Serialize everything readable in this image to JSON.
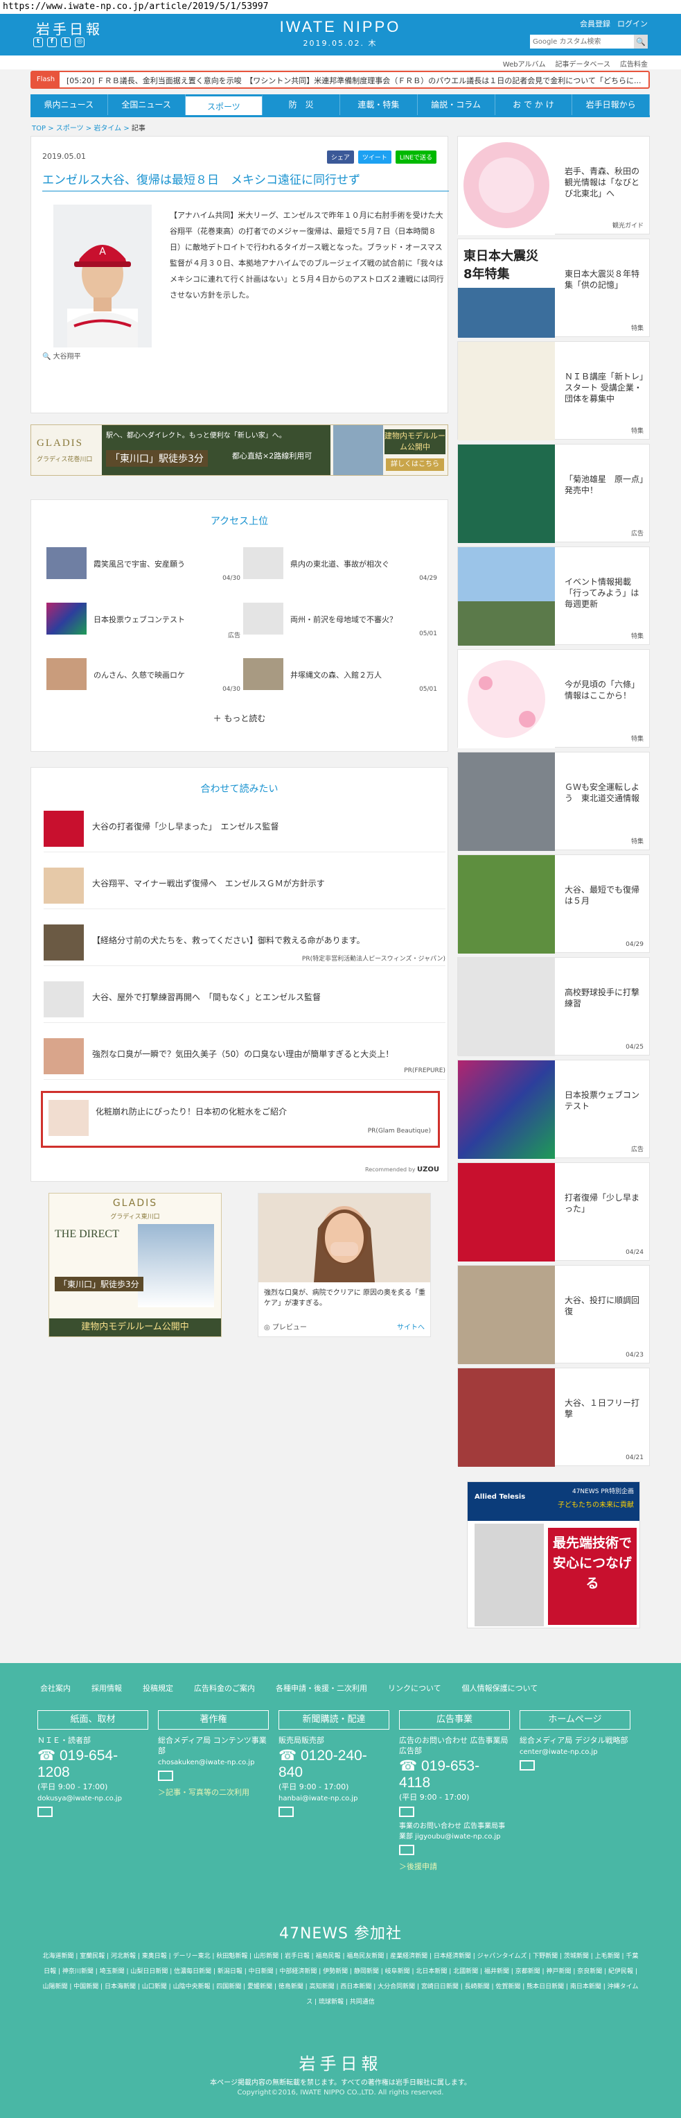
{
  "url": "https://www.iwate-np.co.jp/article/2019/5/1/53997",
  "header": {
    "logo_jp": "岩手日報",
    "logo_en": "IWATE NIPPO",
    "date": "2019.05.02. 木",
    "member_register": "会員登録",
    "login": "ログイン",
    "search_placeholder": "Google カスタム検索",
    "subnav": [
      "Webアルバム",
      "記事データベース",
      "広告料金"
    ]
  },
  "flash": {
    "label": "Flash",
    "text": "[05:20] ＦＲＢ議長、金利当面据え置く意向を示唆　【ワシントン共同】米連邦準備制度理事会（ＦＲＢ）のパウエル議長は１日の記者会見で金利について「どちらに..."
  },
  "gnav": [
    "県内ニュース",
    "全国ニュース",
    "スポーツ",
    "防　災",
    "連載・特集",
    "論説・コラム",
    "お で か け",
    "岩手日報から"
  ],
  "breadcrumb": [
    "TOP",
    "スポーツ",
    "岩タイム",
    "記事"
  ],
  "article": {
    "date": "2019.05.01",
    "share": [
      "シェア",
      "ツイート",
      "LINEで送る"
    ],
    "title": "エンゼルス大谷、復帰は最短８日　メキシコ遠征に同行せず",
    "body": "【アナハイム共同】米大リーグ、エンゼルスで昨年１０月に右肘手術を受けた大谷翔平（花巻東高）の打者でのメジャー復帰は、最短で５月７日（日本時間８日）に敵地デトロイトで行われるタイガース戦となった。ブラッド・オースマス監督が４月３０日、本拠地アナハイムでのブルージェイズ戦の試合前に「我々はメキシコに連れて行く計画はない」と５月４日からのアストロズ２連戦には同行させない方針を示した。",
    "caption": "大谷翔平"
  },
  "banner": {
    "brand": "GLADIS",
    "brand_sub": "グラディス花巻川口",
    "text1": "駅へ、都心へダイレクト。もっと便利な「新しい家」へ。",
    "station": "「東川口」駅徒歩3分",
    "price": "都心直結×2路線利用可",
    "model": "建物内モデルルーム公開中",
    "detail": "詳しくはこちら"
  },
  "access": {
    "title": "アクセス上位",
    "items": [
      {
        "title": "霞笑風呂で宇宙、安産願う",
        "date": "04/30"
      },
      {
        "title": "県内の東北道、事故が相次ぐ",
        "date": "04/29"
      },
      {
        "title": "日本投票ウェブコンテスト",
        "date": "広告"
      },
      {
        "title": "両州・前沢を母地域で不審火？",
        "date": "05/01"
      },
      {
        "title": "のんさん、久慈で映画ロケ",
        "date": "04/30"
      },
      {
        "title": "井塚縄文の森、入館２万人",
        "date": "05/01"
      }
    ],
    "more": "もっと読む"
  },
  "recommend": {
    "title": "合わせて読みたい",
    "items": [
      {
        "title": "大谷の打者復帰「少し早まった」　エンゼルス監督",
        "source": ""
      },
      {
        "title": "大谷翔平、マイナー戦出ず復帰へ　エンゼルスＧＭが方針示す",
        "source": ""
      },
      {
        "title": "【経絡分寸前の犬たちを、救ってください】御料で救える命があります。",
        "source": "PR(特定非営利活動法人ピースウィンズ・ジャパン)"
      },
      {
        "title": "大谷、屋外で打撃練習再開へ　「間もなく」とエンゼルス監督",
        "source": ""
      },
      {
        "title": "強烈な口臭が一瞬で？気田久美子（50）の口臭ない理由が簡単すぎると大炎上！",
        "source": "PR(FREPURE)"
      },
      {
        "title": "化粧崩れ防止にぴったり！日本初の化粧水をご紹介",
        "source": "PR(Glam Beautique)"
      }
    ],
    "recommended_by": "Recommended by",
    "uzou": "UZOU"
  },
  "bottom_ads": {
    "gladis_label": "GLADIS",
    "gladis_sub": "グラディス東川口",
    "gladis_direct": "THE DIRECT",
    "gladis_station": "「東川口」駅徒歩3分",
    "gladis_model": "建物内モデルルーム公開中",
    "ad2_text": "強烈な口臭が、病院でクリアに 原因の奥を炙る「重ケア」が凄すぎる。",
    "ad2_preview": "プレビュー",
    "ad2_site": "サイトへ"
  },
  "sidebar": [
    {
      "title": "岩手、青森、秋田の観光情報は「なびとび北東北」へ",
      "category": "観光ガイド"
    },
    {
      "title": "東日本大震災８年特集「供の記憶」",
      "category": "特集"
    },
    {
      "title": "ＮＩＢ講座「新トレ」スタート 受講企業・団体を募集中",
      "category": "特集"
    },
    {
      "title": "「菊池雄星　原一点」発売中！",
      "category": "広告"
    },
    {
      "title": "イベント情報掲載「行ってみよう」は毎週更新",
      "category": "特集"
    },
    {
      "title": "今が見頃の「六條」情報はここから！",
      "category": "特集"
    },
    {
      "title": "ＧＷも安全運転しよう　東北道交通情報",
      "category": "特集"
    },
    {
      "title": "大谷、最短でも復帰は５月",
      "category": "04/29"
    },
    {
      "title": "高校野球投手に打撃練習",
      "category": "04/25"
    },
    {
      "title": "日本投票ウェブコンテスト",
      "category": "広告"
    },
    {
      "title": "打者復帰「少し早まった」",
      "category": "04/24"
    },
    {
      "title": "大谷、投打に順調回復",
      "category": "04/23"
    },
    {
      "title": "大谷、１日フリー打撃",
      "category": "04/21"
    }
  ],
  "side_ad": {
    "brand": "Allied Telesis",
    "tag": "47NEWS PR特別企画",
    "sub": "子どもたちの未来に貢献",
    "main": "最先端技術で安心につなげる"
  },
  "footer": {
    "links": [
      "会社案内",
      "採用情報",
      "投稿規定",
      "広告料金のご案内",
      "各種申請・後援・二次利用",
      "リンクについて",
      "個人情報保護について"
    ],
    "cols": [
      {
        "head": "紙面、取材",
        "sub": "ＮＩＥ・読者部",
        "phone": "019-654-1208",
        "hours": "(平日 9:00 - 17:00)",
        "mail": "dokusya@iwate-np.co.jp",
        "link": ""
      },
      {
        "head": "著作権",
        "sub": "総合メディア局 コンテンツ事業部",
        "phone": "",
        "hours": "",
        "mail": "chosakuken@iwate-np.co.jp",
        "link": "＞記事・写真等の二次利用"
      },
      {
        "head": "新聞購読・配達",
        "sub": "販売局販売部",
        "phone": "0120-240-840",
        "hours": "(平日 9:00 - 17:00)",
        "mail": "hanbai@iwate-np.co.jp",
        "link": ""
      },
      {
        "head": "広告事業",
        "sub": "広告のお問い合わせ 広告事業局広告部",
        "phone": "019-653-4118",
        "hours": "(平日 9:00 - 17:00)",
        "mail": "事業のお問い合わせ 広告事業局事業部 jigyoubu@iwate-np.co.jp",
        "link": "＞後援申請"
      },
      {
        "head": "ホームページ",
        "sub": "総合メディア局 デジタル戦略部",
        "phone": "",
        "hours": "",
        "mail": "center@iwate-np.co.jp",
        "link": ""
      }
    ],
    "n47_title": "47NEWS 参加社",
    "n47_list": "北海道新聞 | 室蘭民報 | 河北新報 | 東奥日報 | デーリー東北 | 秋田魁新報 | 山形新聞 | 岩手日報 | 福島民報 | 福島民友新聞 | 産業経済新聞 | 日本経済新聞 | ジャパンタイムズ | 下野新聞 | 茨城新聞 | 上毛新聞 | 千葉日報 | 神奈川新聞 | 埼玉新聞 | 山梨日日新聞 | 信濃毎日新聞 | 新潟日報 | 中日新聞 | 中部経済新聞 | 伊勢新聞 | 静岡新聞 | 岐阜新聞 | 北日本新聞 | 北國新聞 | 福井新聞 | 京都新聞 | 神戸新聞 | 奈良新聞 | 紀伊民報 | 山陽新聞 | 中国新聞 | 日本海新聞 | 山口新聞 | 山陰中央新報 | 四国新聞 | 愛媛新聞 | 徳島新聞 | 高知新聞 | 西日本新聞 | 大分合同新聞 | 宮崎日日新聞 | 長崎新聞 | 佐賀新聞 | 熊本日日新聞 | 南日本新聞 | 沖縄タイムス | 琉球新報 | 共同通信",
    "logo": "岩手日報",
    "note": "本ページ掲載内容の無断転載を禁じます。すべての著作権は岩手日報社に属します。",
    "copyright": "Copyright©2016, IWATE NIPPO CO.,LTD. All rights reserved."
  },
  "colors": {
    "brand": "#1a93d0",
    "footer": "#49b7a5",
    "flash": "#e8543c",
    "highlight": "#d0312d"
  }
}
